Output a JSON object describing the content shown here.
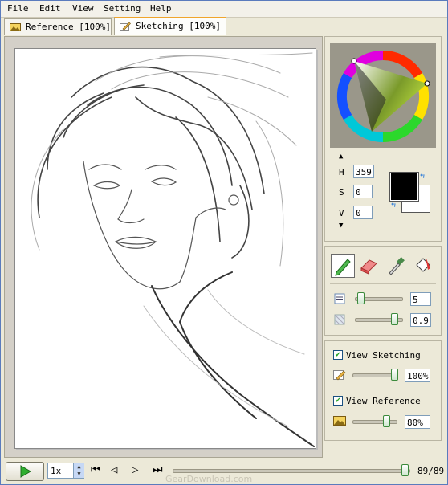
{
  "menu": {
    "file": "File",
    "edit": "Edit",
    "view": "View",
    "setting": "Setting",
    "help": "Help"
  },
  "tabs": [
    {
      "label": "Reference [100%]",
      "active": false
    },
    {
      "label": "Sketching [100%]",
      "active": true
    }
  ],
  "color": {
    "h_label": "H",
    "h_value": "359",
    "s_label": "S",
    "s_value": "0",
    "v_label": "V",
    "v_value": "0",
    "foreground": "#000000",
    "background": "#ffffff"
  },
  "brush": {
    "size_value": "5",
    "opacity_value": "0.9"
  },
  "layers": {
    "sketching_label": "View Sketching",
    "sketching_checked": true,
    "sketching_opacity": "100%",
    "reference_label": "View Reference",
    "reference_checked": true,
    "reference_opacity": "80%"
  },
  "playback": {
    "speed": "1x",
    "position": "89/89",
    "progress": 1.0
  },
  "watermark": "GearDownload.com"
}
